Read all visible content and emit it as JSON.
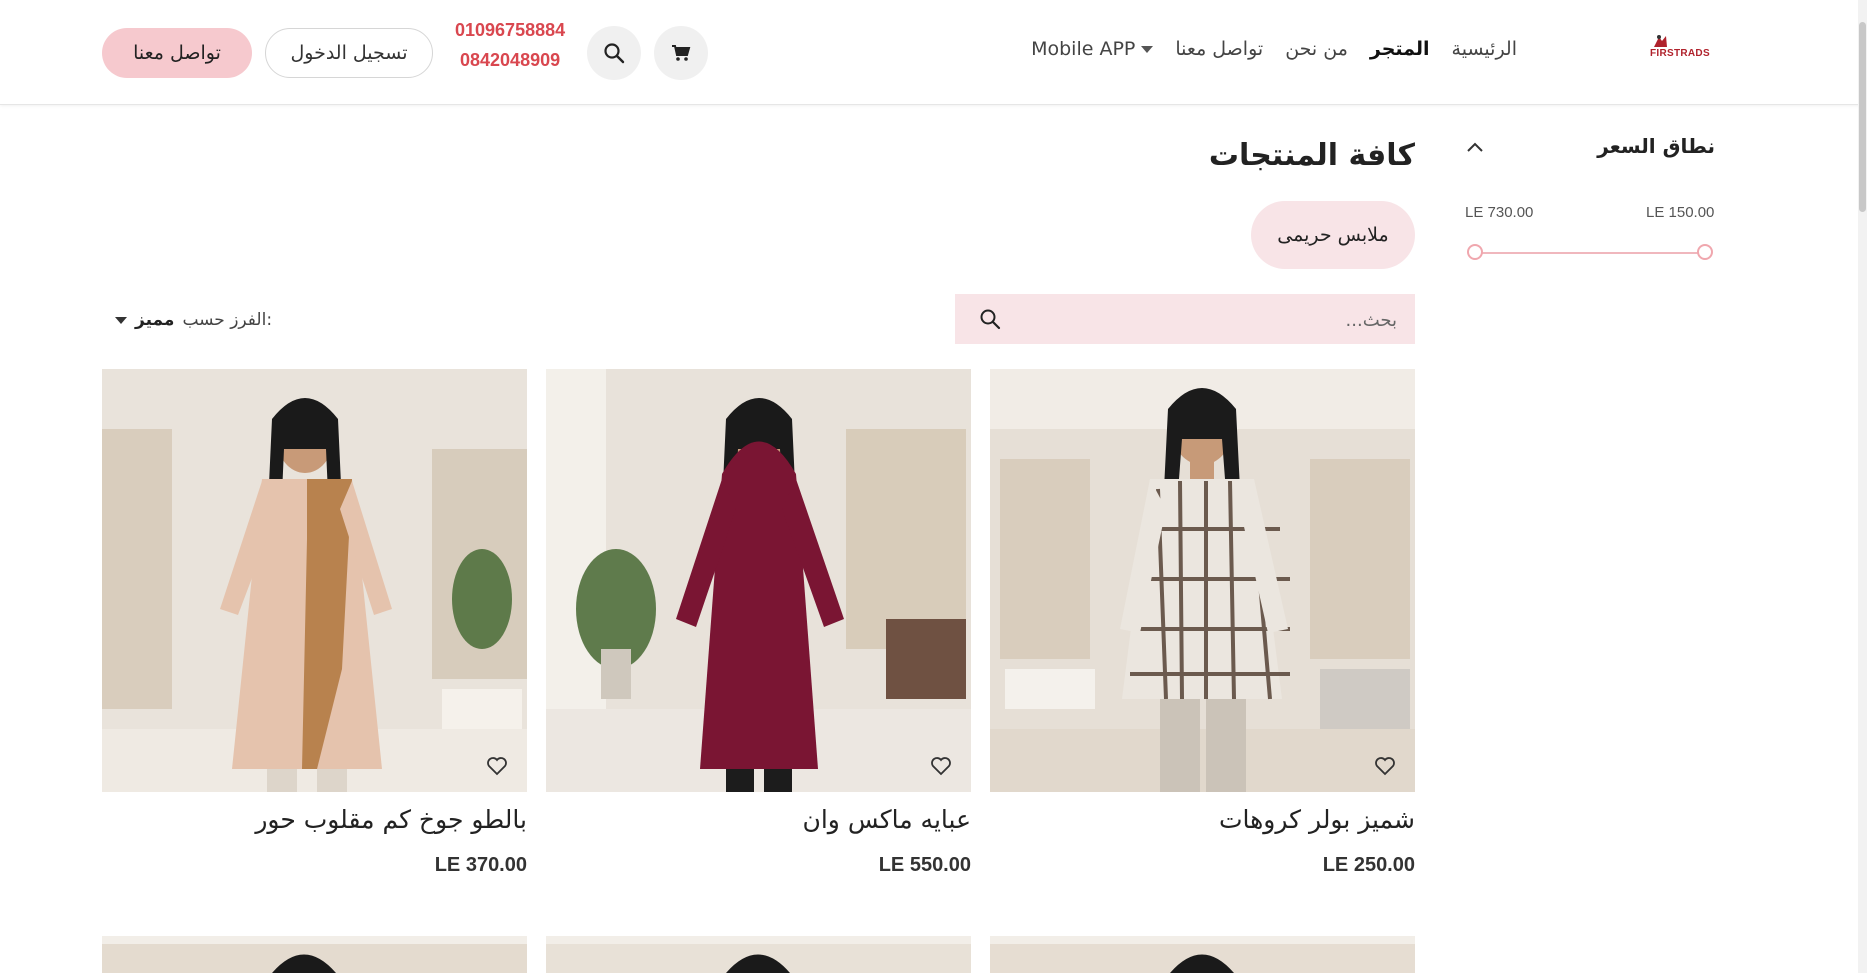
{
  "header": {
    "logo_text": "FIRSTRADS",
    "nav": [
      {
        "label": "الرئيسية"
      },
      {
        "label": "المتجر"
      },
      {
        "label": "من نحن"
      },
      {
        "label": "تواصل معنا"
      },
      {
        "label": "Mobile APP"
      }
    ],
    "phones": [
      "01096758884",
      "0842048909"
    ],
    "login_label": "تسجيل الدخول",
    "contact_label": "تواصل معنا"
  },
  "filters": {
    "title": "نطاق السعر",
    "price_min": "LE 150.00",
    "price_max": "LE 730.00"
  },
  "main": {
    "title": "كافة المنتجات",
    "category_chip": "ملابس حريمى",
    "search_placeholder": "بحث...",
    "sort_label": "الفرز حسب:",
    "sort_value": "مميز"
  },
  "products": [
    {
      "name": "شميز بولر كروهات",
      "price": "LE 250.00"
    },
    {
      "name": "عبايه ماكس وان",
      "price": "LE 550.00"
    },
    {
      "name": "بالطو جوخ كم مقلوب حور",
      "price": "LE 370.00"
    }
  ],
  "colors": {
    "accent": "#d9474f",
    "chip_bg": "#f8e4e7",
    "contact_btn_bg": "#f6c9ce"
  },
  "icons": [
    "cart-icon",
    "search-icon",
    "heart-icon",
    "chevron-up-icon",
    "caret-down-icon"
  ]
}
